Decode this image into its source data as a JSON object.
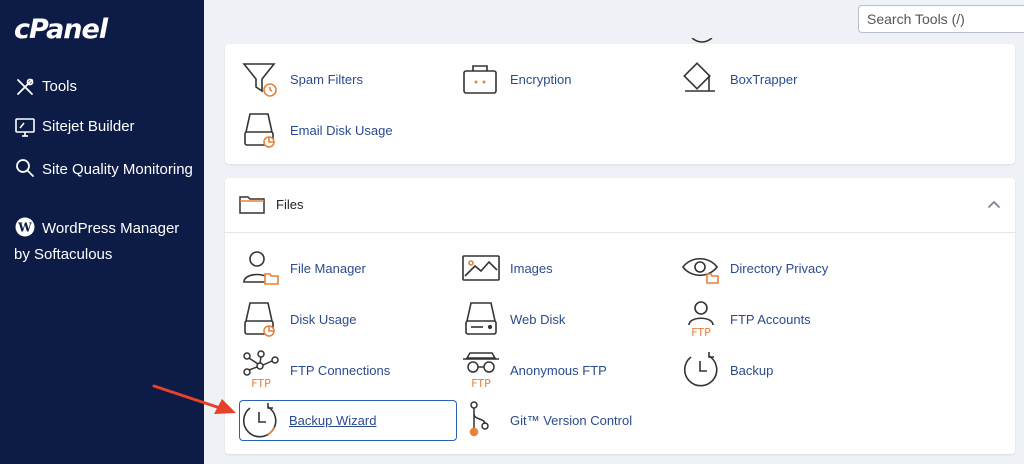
{
  "app": {
    "logo_text": "cPanel"
  },
  "search": {
    "placeholder": "Search Tools (/)"
  },
  "sidebar": {
    "items": [
      {
        "label": "Tools",
        "icon": "tools-icon"
      },
      {
        "label": "Sitejet Builder",
        "icon": "monitor-icon"
      },
      {
        "label": "Site Quality Monitoring",
        "icon": "magnifier-icon"
      },
      {
        "label": "WordPress Manager by Softaculous",
        "icon": "wordpress-icon"
      }
    ]
  },
  "email_section": {
    "items": [
      {
        "label": "Spam Filters",
        "icon": "funnel-icon"
      },
      {
        "label": "Encryption",
        "icon": "lock-box-icon"
      },
      {
        "label": "BoxTrapper",
        "icon": "box-trap-icon"
      },
      {
        "label": "Email Disk Usage",
        "icon": "disk-pie-icon"
      }
    ]
  },
  "files_section": {
    "title": "Files",
    "items": [
      {
        "label": "File Manager",
        "icon": "user-folder-icon"
      },
      {
        "label": "Images",
        "icon": "image-icon"
      },
      {
        "label": "Directory Privacy",
        "icon": "eye-folder-icon"
      },
      {
        "label": "Disk Usage",
        "icon": "disk-pie-icon"
      },
      {
        "label": "Web Disk",
        "icon": "hard-drive-icon"
      },
      {
        "label": "FTP Accounts",
        "icon": "ftp-user-icon"
      },
      {
        "label": "FTP Connections",
        "icon": "ftp-network-icon"
      },
      {
        "label": "Anonymous FTP",
        "icon": "ftp-glasses-icon"
      },
      {
        "label": "Backup",
        "icon": "clock-restore-icon"
      },
      {
        "label": "Backup Wizard",
        "icon": "clock-wand-icon",
        "selected": true
      },
      {
        "label": "Git™ Version Control",
        "icon": "git-branch-icon"
      }
    ],
    "ftp_tag": "FTP"
  },
  "colors": {
    "sidebar_bg": "#0c1c47",
    "link": "#2a4b8f",
    "accent": "#e8813a",
    "selected_border": "#2b5fb8",
    "arrow": "#e8402a"
  }
}
